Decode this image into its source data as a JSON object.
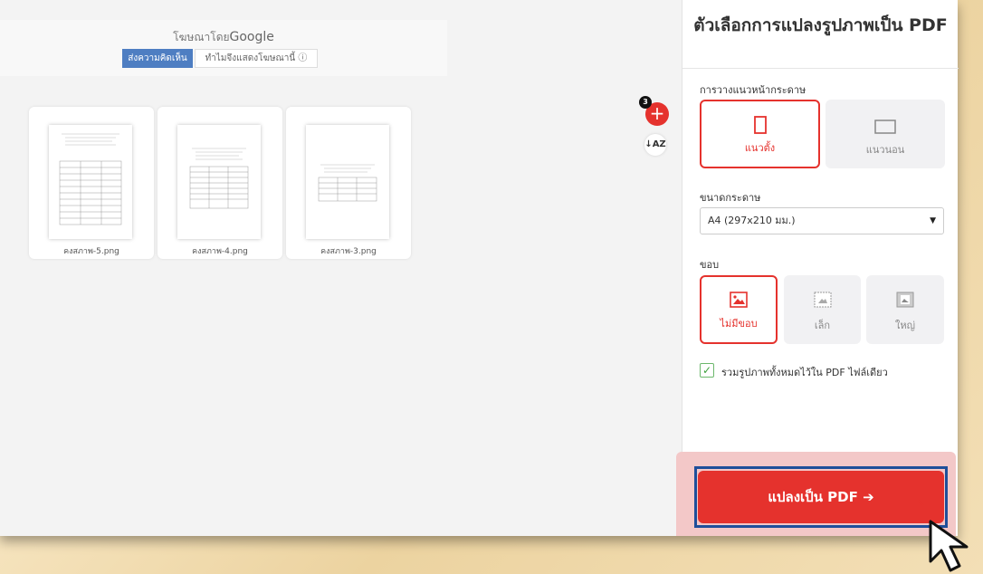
{
  "ad": {
    "title_prefix": "โฆษณาโดย",
    "title_brand": "Google",
    "feedback_label": "ส่งความคิดเห็น",
    "why_label": "ทำไมจึงแสดงโฆษณานี้ ⓘ"
  },
  "files": [
    {
      "name": "คงสภาพ-5.png"
    },
    {
      "name": "คงสภาพ-4.png"
    },
    {
      "name": "คงสภาพ-3.png"
    }
  ],
  "toolbar": {
    "file_count": "3",
    "add_label": "+",
    "sort_label": "↓AZ"
  },
  "sidebar": {
    "title": "ตัวเลือกการแปลงรูปภาพเป็น PDF",
    "orientation_label": "การวางแนวหน้ากระดาษ",
    "orientation": [
      {
        "label": "แนวตั้ง",
        "selected": true,
        "icon": "portrait-page-icon"
      },
      {
        "label": "แนวนอน",
        "selected": false,
        "icon": "landscape-page-icon"
      }
    ],
    "page_size_label": "ขนาดกระดาษ",
    "page_size_value": "A4 (297x210 มม.)",
    "margin_label": "ขอบ",
    "margins": [
      {
        "label": "ไม่มีขอบ",
        "selected": true,
        "icon": "no-margin-icon"
      },
      {
        "label": "เล็ก",
        "selected": false,
        "icon": "small-margin-icon"
      },
      {
        "label": "ใหญ่",
        "selected": false,
        "icon": "big-margin-icon"
      }
    ],
    "merge_label": "รวมรูปภาพทั้งหมดไว้ใน PDF ไฟล์เดียว",
    "merge_checked": true,
    "convert_label": "แปลงเป็น PDF ➔"
  },
  "colors": {
    "accent": "#e5322d",
    "highlight_outline": "#1f4f9a"
  }
}
